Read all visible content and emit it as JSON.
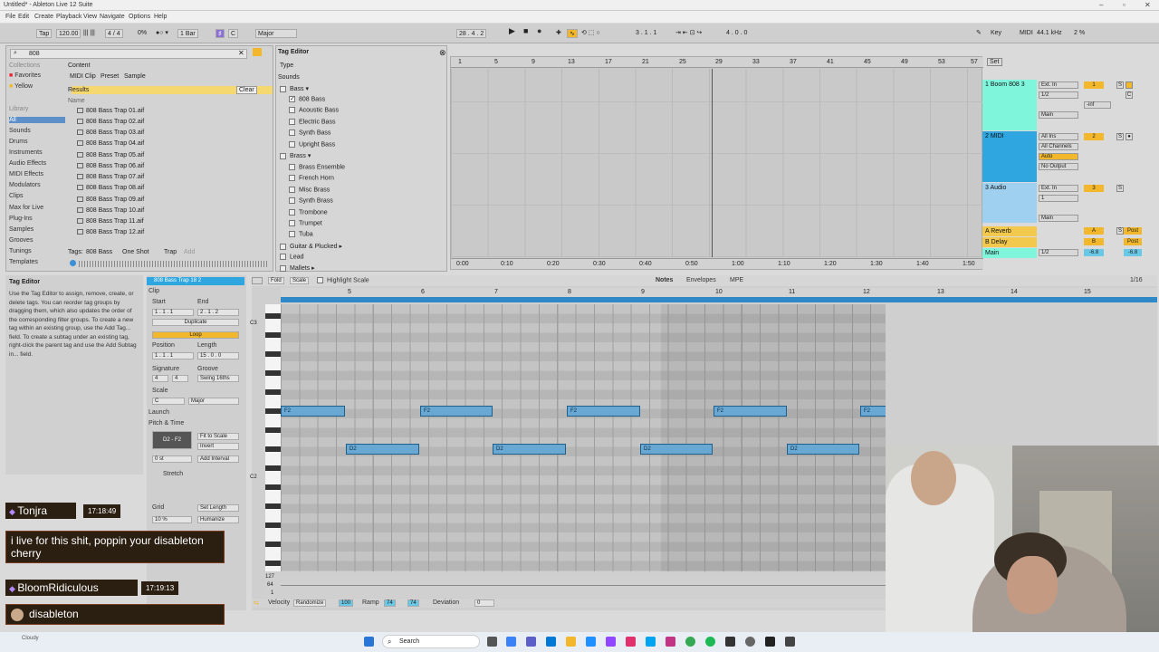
{
  "window": {
    "title": "Untitled* - Ableton Live 12 Suite"
  },
  "menu": [
    "File",
    "Edit",
    "Create",
    "Playback",
    "View",
    "Navigate",
    "Options",
    "Help"
  ],
  "control_bar": {
    "tap": "Tap",
    "tempo": "120.00",
    "sig": "4 / 4",
    "metro_pct": "0%",
    "quant": "1 Bar",
    "key_root": "C",
    "key_scale": "Major",
    "position": "28 . 4 . 2",
    "loop_start": "3 . 1 . 1",
    "loop_len": "4 . 0 . 0",
    "key_label": "Key",
    "midi_label": "MIDI",
    "sample_rate": "44.1 kHz",
    "cpu": "2 %"
  },
  "browser": {
    "search": "808",
    "collections_header": "Collections",
    "collections": [
      "Favorites",
      "Yellow"
    ],
    "library_header": "Library",
    "library": [
      "All",
      "Sounds",
      "Drums",
      "Instruments",
      "Audio Effects",
      "MIDI Effects",
      "Modulators",
      "Clips",
      "Max for Live",
      "Plug-Ins",
      "Samples",
      "Grooves",
      "Tunings",
      "Templates"
    ],
    "content_label": "Content",
    "filters": [
      "MIDI Clip",
      "Preset",
      "Sample"
    ],
    "results_label": "Results",
    "clear_label": "Clear",
    "name_header": "Name",
    "files": [
      "808 Bass Trap 01.aif",
      "808 Bass Trap 02.aif",
      "808 Bass Trap 03.aif",
      "808 Bass Trap 04.aif",
      "808 Bass Trap 05.aif",
      "808 Bass Trap 06.aif",
      "808 Bass Trap 07.aif",
      "808 Bass Trap 08.aif",
      "808 Bass Trap 09.aif",
      "808 Bass Trap 10.aif",
      "808 Bass Trap 11.aif",
      "808 Bass Trap 12.aif"
    ],
    "tags_label": "Tags:",
    "tags": [
      "808 Bass",
      "One Shot",
      "Trap"
    ],
    "add_tag": "Add"
  },
  "tag_editor": {
    "title": "Tag Editor",
    "type_label": "Type",
    "sounds_label": "Sounds",
    "bass_label": "Bass",
    "bass_items": [
      {
        "label": "808 Bass",
        "checked": true
      },
      {
        "label": "Acoustic Bass",
        "checked": false
      },
      {
        "label": "Electric Bass",
        "checked": false
      },
      {
        "label": "Synth Bass",
        "checked": false
      },
      {
        "label": "Upright Bass",
        "checked": false
      }
    ],
    "brass_label": "Brass",
    "brass_items": [
      "Brass Ensemble",
      "French Horn",
      "Misc Brass",
      "Synth Brass",
      "Trombone",
      "Trumpet",
      "Tuba"
    ],
    "guitar_label": "Guitar & Plucked",
    "lead_label": "Lead",
    "mallets_label": "Mallets"
  },
  "arrangement": {
    "bars": [
      "1",
      "5",
      "9",
      "13",
      "17",
      "21",
      "25",
      "29",
      "33",
      "37",
      "41",
      "45",
      "49",
      "53",
      "57"
    ],
    "times": [
      "0:00",
      "0:10",
      "0:20",
      "0:30",
      "0:40",
      "0:50",
      "1:00",
      "1:10",
      "1:20",
      "1:30",
      "1:40",
      "1:50"
    ],
    "set_label": "Set",
    "tracks": [
      {
        "name": "1 Boom 808 3",
        "color": "#7ff5dc",
        "input": "Ext. In",
        "ch": "1/2",
        "out": "Main",
        "num": "1"
      },
      {
        "name": "2 MIDI",
        "color": "#2fa6e0",
        "input": "All Ins",
        "ch": "All Channels",
        "out": "No Output",
        "num": "2"
      },
      {
        "name": "3 Audio",
        "color": "#9fd0f0",
        "input": "Ext. In",
        "ch": "1",
        "out": "Main",
        "num": "3"
      }
    ],
    "returns": [
      {
        "name": "A Reverb",
        "letter": "A"
      },
      {
        "name": "B Delay",
        "letter": "B"
      }
    ],
    "main": {
      "name": "Main",
      "ch": "1/2",
      "vol": "-6.8",
      "pan": "-6.8"
    },
    "auto_label": "Auto",
    "off_label": "Off",
    "in_label": "In",
    "post_label": "Post",
    "s_label": "S",
    "c_label": "C",
    "inf": "-inf",
    "io_label": "1/1"
  },
  "info": {
    "title": "Tag Editor",
    "text": "Use the Tag Editor to assign, remove, create, or delete tags. You can reorder tag groups by dragging them, which also updates the order of the corresponding filter groups. To create a new tag within an existing group, use the Add Tag... field. To create a subtag under an existing tag, right-click the parent tag and use the Add Subtag in... field."
  },
  "clip": {
    "name": "808 Bass Trap 18 2",
    "clip_label": "Clip",
    "start_label": "Start",
    "end_label": "End",
    "set_label": "Set",
    "start": "1 . 1 . 1",
    "end": "2 . 1 . 2",
    "duplicate": "Duplicate",
    "loop": "Loop",
    "position_label": "Position",
    "length_label": "Length",
    "position": "1 . 1 . 1",
    "length": "15 . 0 . 0",
    "signature_label": "Signature",
    "groove_label": "Groove",
    "sig_num": "4",
    "sig_den": "4",
    "groove": "Swing 16ths",
    "scale_label": "Scale",
    "scale_root": "C",
    "scale_name": "Major",
    "launch_label": "Launch",
    "pitch_label": "Pitch & Time",
    "range": "D2 - F2",
    "fit_scale": "Fit to Scale",
    "invert": "Invert",
    "semis": "0 st",
    "add_interval": "Add Interval",
    "stretch": "Stretch",
    "set_length": "Set Length",
    "humanize": "Humanize",
    "grid_label": "Grid",
    "pct": "10 %"
  },
  "midi_editor": {
    "fold": "Fold",
    "scale": "Scale",
    "highlight": "Highlight Scale",
    "tabs": [
      "Notes",
      "Envelopes",
      "MPE"
    ],
    "grid_value": "1/16",
    "bars": [
      "5",
      "6",
      "7",
      "8",
      "9",
      "10",
      "11",
      "12",
      "13",
      "14",
      "15"
    ],
    "key_c3": "C3",
    "key_c2": "C2",
    "notes_f2": [
      "F2",
      "F2",
      "F2",
      "F2",
      "F2"
    ],
    "notes_d2": [
      "D2",
      "D2",
      "D2",
      "D2",
      "D2"
    ],
    "vel_top": "127",
    "vel_mid": "64",
    "vel_bot": "1",
    "velocity_label": "Velocity",
    "randomize_label": "Randomize",
    "vel_value": "100",
    "ramp_label": "Ramp",
    "ramp_a": "74",
    "ramp_b": "74",
    "deviation_label": "Deviation",
    "deviation": "0"
  },
  "chat": [
    {
      "user": "Tonjra",
      "time": "17:18:49",
      "message": "i live for this shit, poppin your disableton cherry"
    },
    {
      "user": "BloomRidiculous",
      "time": "17:19:13",
      "message": "disableton"
    }
  ],
  "taskbar": {
    "search": "Search",
    "weather": "Cloudy"
  },
  "colors": {
    "accent_yellow": "#f2b72a",
    "note_blue": "#69a8d2",
    "loop_blue": "#2f88c7",
    "chat_bg": "#2b1f12"
  }
}
